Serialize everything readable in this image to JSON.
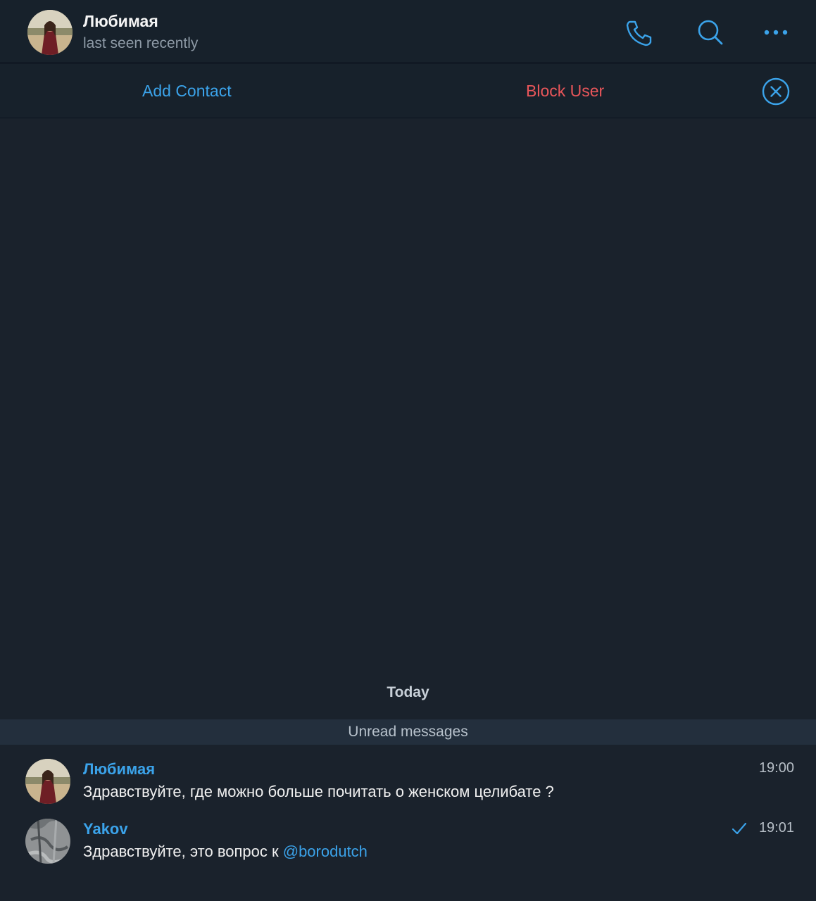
{
  "header": {
    "title": "Любимая",
    "status": "last seen recently",
    "icons": [
      "phone-icon",
      "search-icon",
      "more-icon"
    ]
  },
  "action_bar": {
    "add_contact": "Add Contact",
    "block_user": "Block User",
    "close_icon": "close-circle-icon"
  },
  "chat": {
    "date_label": "Today",
    "unread_label": "Unread messages",
    "messages": [
      {
        "author": "Любимая",
        "text": "Здравствуйте, где можно больше почитать о женском целибате ?",
        "time": "19:00"
      },
      {
        "author": "Yakov",
        "text_prefix": "Здравствуйте, это вопрос к ",
        "mention": "@borodutch",
        "time": "19:01",
        "status_icon": "check-icon"
      }
    ]
  },
  "colors": {
    "accent": "#3ba3ea",
    "danger": "#e9565a",
    "background": "#17212b",
    "chat_background": "#1a222c"
  }
}
